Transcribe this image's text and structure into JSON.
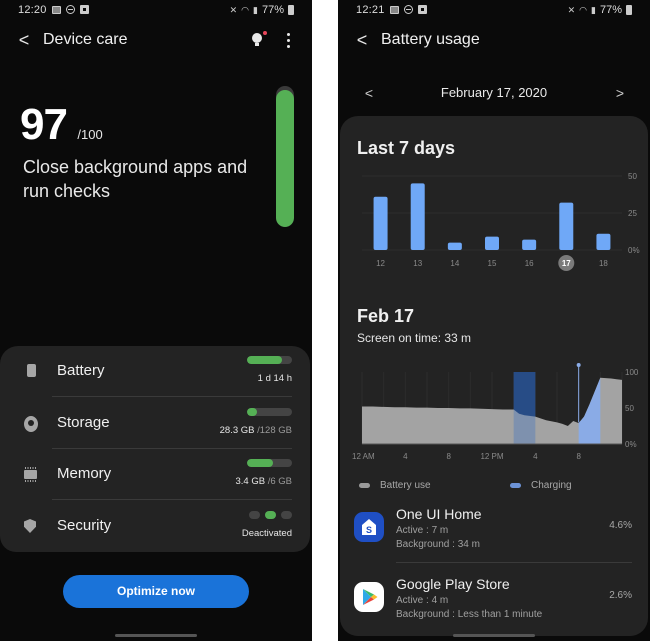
{
  "left_screen": {
    "statusbar": {
      "time": "12:20",
      "battery": "77%"
    },
    "header": {
      "title": "Device care",
      "back_label": "<"
    },
    "score": {
      "value": "97",
      "max": "/100",
      "fill_fraction": 0.97,
      "message": "Close background apps and run checks"
    },
    "items": [
      {
        "label": "Battery",
        "icon": "battery-icon",
        "value": "1 d 14 h",
        "sub": "",
        "meter_fraction": 0.78
      },
      {
        "label": "Storage",
        "icon": "storage-icon",
        "value": "28.3 GB",
        "sub": " /128 GB",
        "meter_fraction": 0.22
      },
      {
        "label": "Memory",
        "icon": "memory-icon",
        "value": "3.4 GB",
        "sub": " /6 GB",
        "meter_fraction": 0.57
      },
      {
        "label": "Security",
        "icon": "shield-icon",
        "value": "Deactivated",
        "sub": "",
        "dots": [
          "off",
          "on",
          "off"
        ]
      }
    ],
    "optimize_button": "Optimize now",
    "colors": {
      "accent_green": "#55b055",
      "button_blue": "#1a73d9"
    }
  },
  "right_screen": {
    "statusbar": {
      "time": "12:21",
      "battery": "77%"
    },
    "header": {
      "title": "Battery usage",
      "back_label": "<"
    },
    "date_nav": {
      "prev": "<",
      "label": "February 17, 2020",
      "next": ">"
    },
    "weekly": {
      "title": "Last 7 days"
    },
    "daily": {
      "title": "Feb 17",
      "screen_on": "Screen on time: 33 m"
    },
    "legend": [
      {
        "label": "Battery use",
        "color": "#9a9a9a"
      },
      {
        "label": "Charging",
        "color": "#6d93d6"
      }
    ],
    "apps": [
      {
        "name": "One UI Home",
        "icon": "one-ui-home-icon",
        "active": "Active : 7 m",
        "background": "Background : 34 m",
        "percent": "4.6%"
      },
      {
        "name": "Google Play Store",
        "icon": "play-store-icon",
        "active": "Active : 4 m",
        "background": "Background : Less than 1 minute",
        "percent": "2.6%"
      }
    ]
  },
  "chart_data": [
    {
      "type": "bar",
      "title": "Last 7 days",
      "categories": [
        "12",
        "13",
        "14",
        "15",
        "16",
        "17",
        "18"
      ],
      "values": [
        36,
        45,
        5,
        9,
        7,
        32,
        11
      ],
      "selected_category": "17",
      "ylim": [
        0,
        50
      ],
      "yticks": [
        "0%",
        "25",
        "50"
      ],
      "ytick_values": [
        0,
        25,
        50
      ],
      "color": "#6fa8f7",
      "ylabel": "",
      "xlabel": ""
    },
    {
      "type": "area",
      "title": "Feb 17",
      "x_hours": [
        0,
        1,
        2,
        3,
        4,
        5,
        6,
        7,
        8,
        9,
        10,
        11,
        12,
        13,
        14,
        14.5,
        15,
        16,
        17,
        18,
        18.5,
        19,
        19.5,
        20,
        20.5,
        21,
        22,
        23,
        23.5,
        24
      ],
      "battery_pct": [
        52,
        52,
        51.5,
        51,
        51,
        50.5,
        50.5,
        50,
        50,
        49.5,
        49.5,
        49,
        48.5,
        48,
        48,
        42,
        40,
        38,
        33,
        30,
        28,
        25,
        32,
        29,
        38,
        55,
        92,
        91,
        90,
        89
      ],
      "charging_ranges": [
        [
          20,
          22
        ]
      ],
      "highlight_ranges": [
        [
          14,
          16
        ]
      ],
      "charge_marker_hour": 20,
      "ylim": [
        0,
        100
      ],
      "yticks": [
        "0%",
        "50",
        "100"
      ],
      "ytick_values": [
        0,
        50,
        100
      ],
      "xticks": [
        "12 AM",
        "4",
        "8",
        "12 PM",
        "4",
        "8"
      ],
      "xtick_hours": [
        0,
        4,
        8,
        12,
        16,
        20
      ],
      "series": [
        {
          "name": "Battery use",
          "color": "#a3a3a3"
        },
        {
          "name": "Charging",
          "color": "#8aabe6"
        }
      ]
    }
  ]
}
